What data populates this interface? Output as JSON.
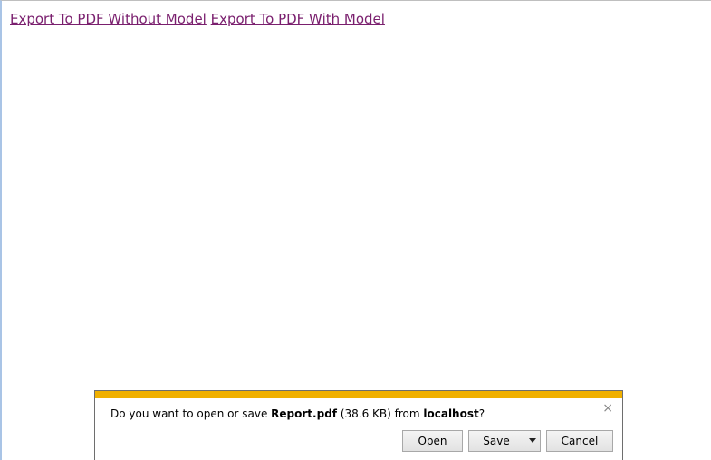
{
  "links": {
    "export_without_model": "Export To PDF Without Model",
    "export_with_model": "Export To PDF With Model"
  },
  "download_bar": {
    "message_prefix": "Do you want to open or save ",
    "file_name": "Report.pdf",
    "file_size": " (38.6 KB) from ",
    "host": "localhost",
    "message_suffix": "?",
    "close_glyph": "×",
    "open_label": "Open",
    "save_label": "Save",
    "cancel_label": "Cancel",
    "accent_color": "#f0b000"
  }
}
